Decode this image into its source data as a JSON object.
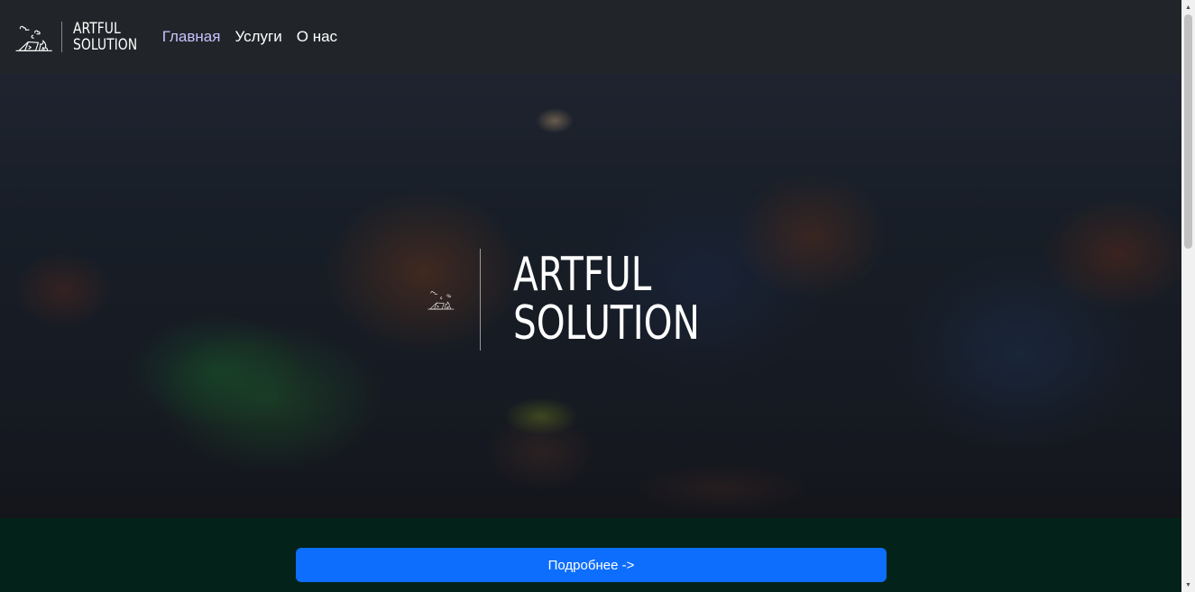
{
  "brand": {
    "line1": "ARTFUL",
    "line2": "SOLUTION",
    "logo_icon": "camping-tent-icon"
  },
  "nav": {
    "items": [
      {
        "label": "Главная",
        "active": true
      },
      {
        "label": "Услуги",
        "active": false
      },
      {
        "label": "О нас",
        "active": false
      }
    ]
  },
  "hero": {
    "title_line1": "ARTFUL",
    "title_line2": "SOLUTION",
    "logo_icon": "camping-tent-icon"
  },
  "cta": {
    "button_label": "Подробнее ->"
  },
  "colors": {
    "navbar_bg": "#212529",
    "nav_active": "#c9c2ff",
    "cta_bg": "#03231a",
    "button_primary": "#0d6efd"
  }
}
